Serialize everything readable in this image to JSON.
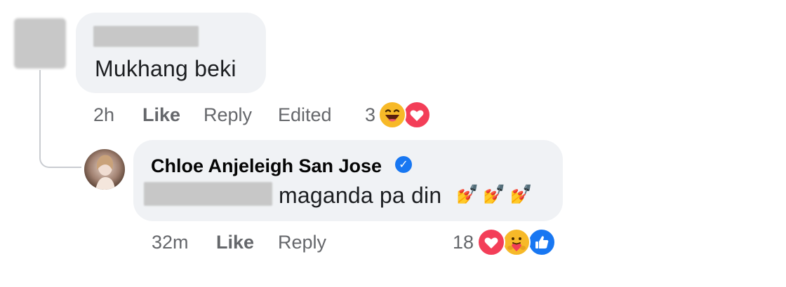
{
  "comment": {
    "text": "Mukhang beki",
    "time": "2h",
    "like_label": "Like",
    "reply_label": "Reply",
    "edited_label": "Edited",
    "reaction_count": "3",
    "reactions": [
      "laugh-icon",
      "heart-icon"
    ]
  },
  "reply": {
    "author": "Chloe Anjeleigh San Jose",
    "verified": true,
    "text": "maganda pa din",
    "emoji": "💅💅💅",
    "time": "32m",
    "like_label": "Like",
    "reply_label": "Reply",
    "reaction_count": "18",
    "reactions": [
      "heart-icon",
      "care-icon",
      "thumbs-up-icon"
    ]
  },
  "colors": {
    "bubble": "#f0f2f5",
    "meta_text": "#65676b",
    "like_blue": "#1877f2",
    "love_red": "#f33e58",
    "haha_yellow": "#f7b928"
  }
}
